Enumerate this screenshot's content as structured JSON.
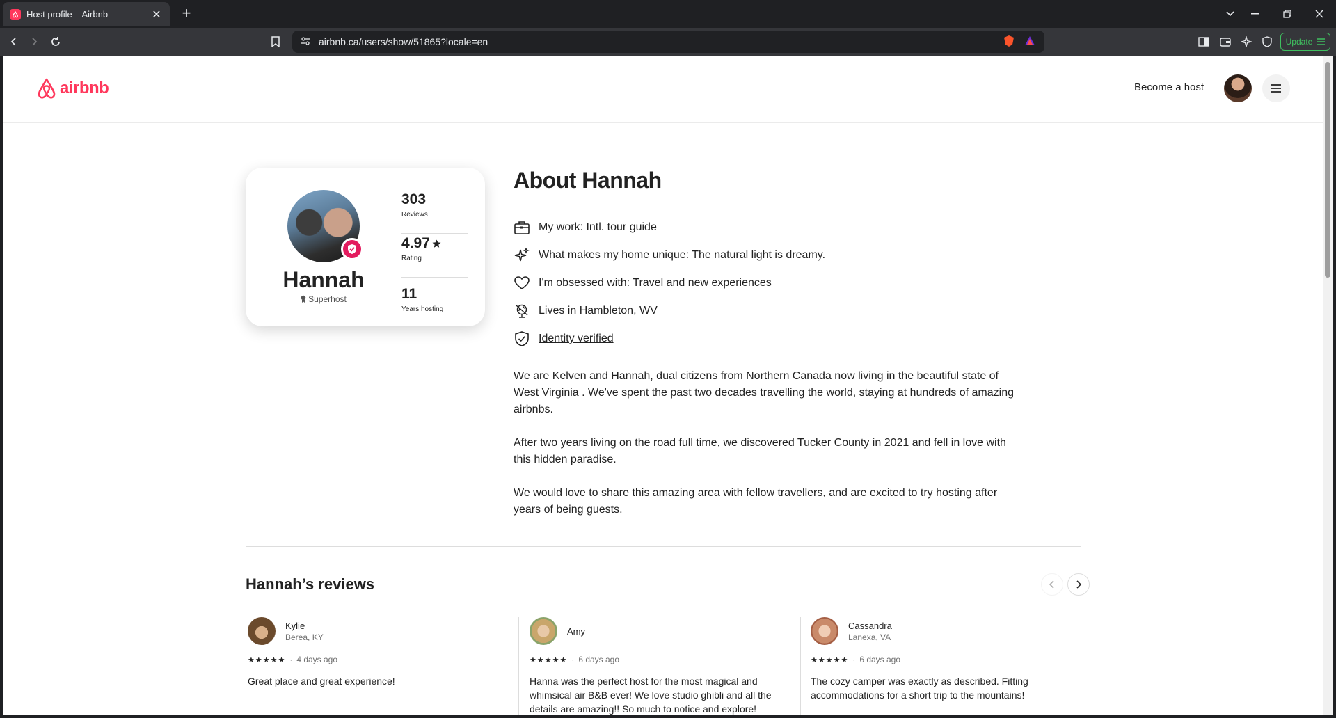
{
  "browser": {
    "tab_title": "Host profile – Airbnb",
    "url": "airbnb.ca/users/show/51865?locale=en",
    "update_label": "Update"
  },
  "header": {
    "logo_text": "airbnb",
    "become_host": "Become a host"
  },
  "profile": {
    "name": "Hannah",
    "role": "Superhost",
    "stats": [
      {
        "value": "303",
        "label": "Reviews"
      },
      {
        "value": "4.97",
        "label": "Rating"
      },
      {
        "value": "11",
        "label": "Years hosting"
      }
    ]
  },
  "about": {
    "title": "About Hannah",
    "facts": [
      {
        "icon": "briefcase-icon",
        "text": "My work: Intl. tour guide"
      },
      {
        "icon": "sparkles-icon",
        "text": "What makes my home unique: The natural light is dreamy."
      },
      {
        "icon": "heart-icon",
        "text": "I'm obsessed with: Travel and new experiences"
      },
      {
        "icon": "globe-icon",
        "text": "Lives in Hambleton, WV"
      },
      {
        "icon": "shield-check-icon",
        "text": "Identity verified"
      }
    ],
    "bio": [
      "We are Kelven and Hannah, dual citizens from Northern Canada now living in the  beautiful state of West Virginia .  We've spent the past two decades travelling the world, staying at hundreds of amazing airbnbs.",
      "After two years living on the road full time, we discovered Tucker County in 2021 and fell in love with this hidden paradise.",
      "We would love to share this amazing area with fellow travellers, and are excited to try hosting after years of being guests."
    ]
  },
  "reviews": {
    "title": "Hannah’s reviews",
    "items": [
      {
        "name": "Kylie",
        "location": "Berea, KY",
        "stars": "★★★★★",
        "when": "4 days ago",
        "text": "Great place and great experience!",
        "color": "#b8865a"
      },
      {
        "name": "Amy",
        "location": "",
        "stars": "★★★★★",
        "when": "6 days ago",
        "text": "Hanna was the perfect host for the most magical and whimsical air B&B ever! We love studio ghibli and all the details are amazing!! So much to notice and explore!",
        "color": "#c9a66b"
      },
      {
        "name": "Cassandra",
        "location": "Lanexa, VA",
        "stars": "★★★★★",
        "when": "6 days ago",
        "text": "The cozy camper was exactly as described. Fitting accommodations for a short trip to the mountains!",
        "color": "#c98a6a"
      }
    ]
  },
  "colors": {
    "brand": "#ff385c",
    "badge": "#e31c5f"
  }
}
